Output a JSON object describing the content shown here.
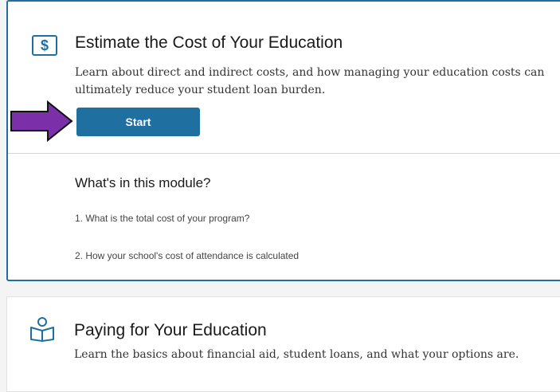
{
  "module1": {
    "icon": "dollar-sign-icon",
    "icon_glyph": "$",
    "title": "Estimate the Cost of Your Education",
    "description": "Learn about direct and indirect costs, and how managing your education costs can ultimately reduce your student loan burden.",
    "start_label": "Start",
    "whats_in_title": "What's in this module?",
    "items": [
      "1. What is the total cost of your program?",
      "2. How your school's cost of attendance is calculated"
    ]
  },
  "module2": {
    "icon": "reading-person-icon",
    "title": "Paying for Your Education",
    "description": "Learn the basics about financial aid, student loans, and what your options are."
  },
  "colors": {
    "accent": "#1f6fa0",
    "arrow": "#7b2fa8"
  }
}
